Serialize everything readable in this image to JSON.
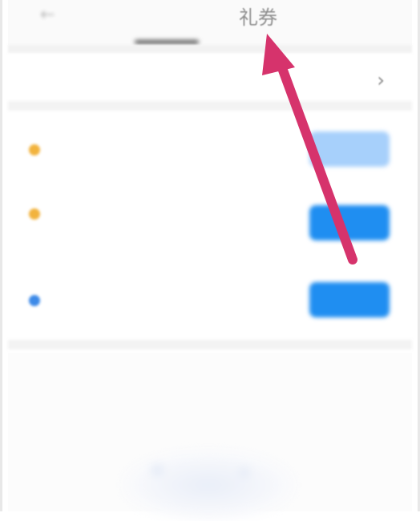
{
  "header": {
    "back_icon": "back-arrow-icon",
    "tabs": [
      {
        "label": "",
        "active": false
      },
      {
        "label": "礼券",
        "active": true
      }
    ]
  },
  "security": {
    "label": "",
    "chevron": "›"
  },
  "accounts": [
    {
      "label": "",
      "value": "",
      "dot_color": "#f2b33d",
      "button_label": "",
      "button_color": "#a7d0fb"
    },
    {
      "label": "",
      "value": "",
      "dot_color": "#f2b33d",
      "button_label": "",
      "button_color": "#1f8ef1"
    },
    {
      "label": "",
      "value": "",
      "dot_color": "#3d8ae8",
      "button_label": "",
      "button_color": "#1f8ef1"
    }
  ],
  "history": {
    "title": ""
  },
  "annotation": {
    "color": "#d6336c"
  }
}
